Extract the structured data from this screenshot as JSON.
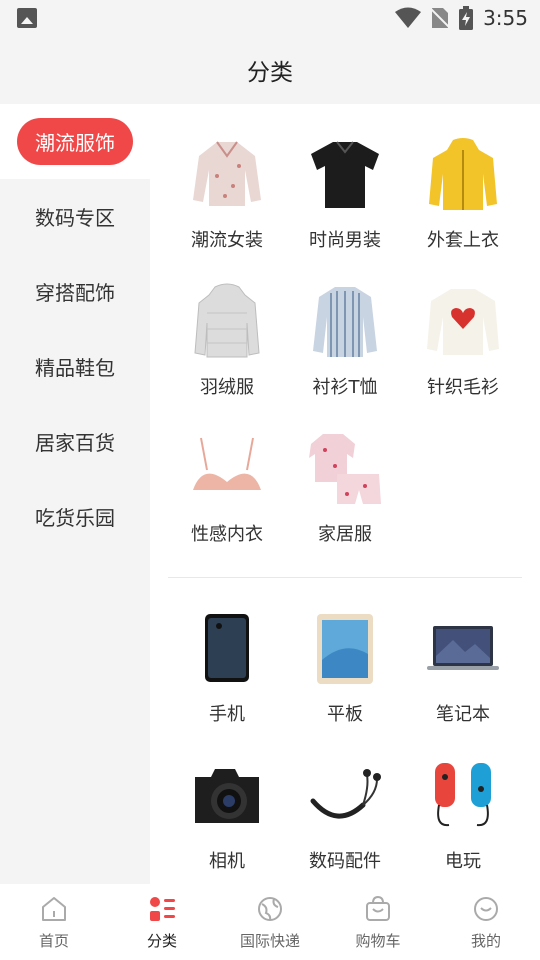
{
  "status": {
    "time": "3:55"
  },
  "header": {
    "title": "分类"
  },
  "sidebar": {
    "items": [
      {
        "label": "潮流服饰",
        "active": true
      },
      {
        "label": "数码专区"
      },
      {
        "label": "穿搭配饰"
      },
      {
        "label": "精品鞋包"
      },
      {
        "label": "居家百货"
      },
      {
        "label": "吃货乐园"
      }
    ]
  },
  "content": {
    "groups": [
      {
        "items": [
          {
            "label": "潮流女装",
            "icon": "floral-blouse"
          },
          {
            "label": "时尚男装",
            "icon": "black-polo-shirt"
          },
          {
            "label": "外套上衣",
            "icon": "yellow-jacket"
          },
          {
            "label": "羽绒服",
            "icon": "down-jacket"
          },
          {
            "label": "衬衫T恤",
            "icon": "striped-shirt"
          },
          {
            "label": "针织毛衫",
            "icon": "heart-sweater"
          },
          {
            "label": "性感内衣",
            "icon": "lace-bra"
          },
          {
            "label": "家居服",
            "icon": "pajamas"
          }
        ]
      },
      {
        "items": [
          {
            "label": "手机",
            "icon": "smartphone"
          },
          {
            "label": "平板",
            "icon": "tablet"
          },
          {
            "label": "笔记本",
            "icon": "laptop"
          },
          {
            "label": "相机",
            "icon": "camera"
          },
          {
            "label": "数码配件",
            "icon": "neckband-earphones"
          },
          {
            "label": "电玩",
            "icon": "game-controllers"
          }
        ]
      }
    ]
  },
  "tabbar": {
    "items": [
      {
        "label": "首页",
        "icon": "home-icon"
      },
      {
        "label": "分类",
        "icon": "category-icon",
        "active": true
      },
      {
        "label": "国际快递",
        "icon": "globe-icon"
      },
      {
        "label": "购物车",
        "icon": "bag-icon"
      },
      {
        "label": "我的",
        "icon": "profile-icon"
      }
    ]
  },
  "colors": {
    "accent": "#f04848",
    "background": "#f4f4f4"
  }
}
